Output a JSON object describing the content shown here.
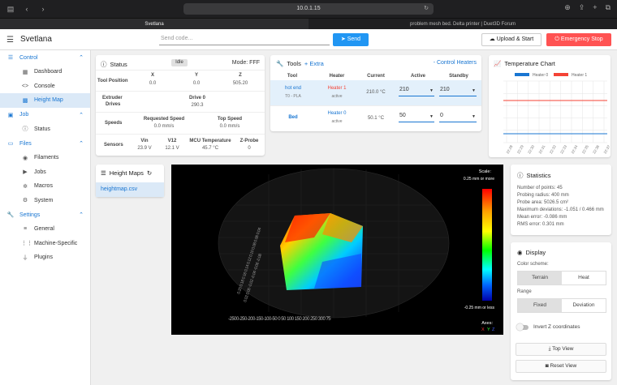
{
  "browser": {
    "url": "10.0.1.15",
    "tabs": [
      "Svetlana",
      "problem mesh bed. Delta printer | Duet3D Forum"
    ]
  },
  "appbar": {
    "title": "Svetlana",
    "send_placeholder": "Send code...",
    "send_label": "Send",
    "upload_label": "Upload & Start",
    "estop_label": "Emergency Stop"
  },
  "sidebar": {
    "control": "Control",
    "control_items": [
      "Dashboard",
      "Console",
      "Height Map"
    ],
    "job": "Job",
    "job_items": [
      "Status"
    ],
    "files": "Files",
    "files_items": [
      "Filaments",
      "Jobs",
      "Macros",
      "System"
    ],
    "settings": "Settings",
    "settings_items": [
      "General",
      "Machine-Specific",
      "Plugins"
    ]
  },
  "status": {
    "title": "Status",
    "state": "Idle",
    "mode": "Mode: FFF",
    "tool_position": "Tool Position",
    "x_label": "X",
    "y_label": "Y",
    "z_label": "Z",
    "x": "0.0",
    "y": "0.0",
    "z": "505.20",
    "extruder": "Extruder",
    "drives": "Drives",
    "drive0_label": "Drive 0",
    "drive0": "290.3",
    "speeds": "Speeds",
    "req_speed_label": "Requested Speed",
    "req_speed": "0.0 mm/s",
    "top_speed_label": "Top Speed",
    "top_speed": "0.0 mm/s",
    "sensors": "Sensors",
    "vin_label": "Vin",
    "vin": "23.9 V",
    "v12_label": "V12",
    "v12": "12.1 V",
    "mcu_label": "MCU Temperature",
    "mcu": "45.7 °C",
    "zprobe_label": "Z-Probe",
    "zprobe": "0"
  },
  "tools": {
    "title": "Tools",
    "extra": "+ Extra",
    "control_heaters": "Control Heaters",
    "cols": [
      "Tool",
      "Heater",
      "Current",
      "Active",
      "Standby"
    ],
    "hotend": {
      "name": "hot end",
      "sub": "T0 - PLA",
      "heater": "Heater 1",
      "heater_state": "active",
      "current": "210.0 °C",
      "active": "210",
      "standby": "210"
    },
    "bed": {
      "name": "Bed",
      "heater": "Heater 0",
      "heater_state": "active",
      "current": "50.1 °C",
      "active": "50",
      "standby": "0"
    }
  },
  "temp_chart": {
    "title": "Temperature Chart",
    "legend": [
      "Heater 0",
      "Heater 1"
    ],
    "times": [
      "22:28",
      "22:29",
      "22:30",
      "22:31",
      "22:32",
      "22:33",
      "22:34",
      "22:35",
      "22:36",
      "22:37"
    ],
    "y_ticks": [
      "250",
      "200",
      "150",
      "100",
      "50",
      "0"
    ]
  },
  "heightmaps": {
    "title": "Height Maps",
    "file": "heightmap.csv"
  },
  "viz": {
    "scale": "Scale:",
    "top": "0.25 mm or more",
    "bottom": "-0.25 mm or less",
    "axes": "Axes:",
    "ax_x": "X",
    "ax_y": "Y",
    "ax_z": "Z"
  },
  "stats": {
    "title": "Statistics",
    "lines": [
      "Number of points: 45",
      "Probing radius: 400 mm",
      "Probe area: 5026.5 cm²",
      "Maximum deviations: -1.051 / 0.466 mm",
      "Mean error: -0.086 mm",
      "RMS error: 0.301 mm"
    ]
  },
  "display": {
    "title": "Display",
    "color_scheme": "Color scheme:",
    "terrain": "Terrain",
    "heat": "Heat",
    "range": "Range",
    "fixed": "Fixed",
    "deviation": "Deviation",
    "invert_z": "Invert Z coordinates",
    "top_view": "Top View",
    "reset_view": "Reset View"
  },
  "colors": {
    "accent": "#1976d2",
    "estop": "#ff5252",
    "send": "#2196f3",
    "heater0": "#1976d2",
    "heater1": "#f44336"
  }
}
